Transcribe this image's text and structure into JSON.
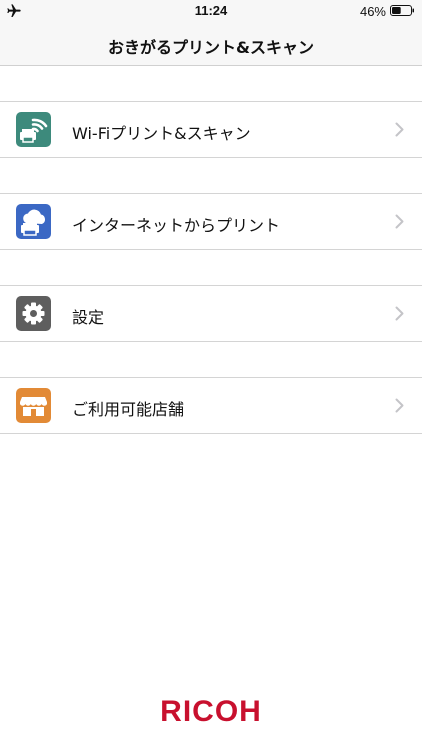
{
  "status_bar": {
    "time": "11:24",
    "battery_percent": "46%",
    "battery_level": 0.46,
    "mode_icon": "airplane-icon"
  },
  "nav": {
    "title": "おきがるプリント&スキャン"
  },
  "menu": [
    {
      "label": "Wi-Fiプリント&スキャン",
      "icon": "wifi-printer-icon",
      "color": "#3d8a7c"
    },
    {
      "label": "インターネットからプリント",
      "icon": "cloud-printer-icon",
      "color": "#3b68c4"
    },
    {
      "label": "設定",
      "icon": "gear-icon",
      "color": "#5e5e5e"
    },
    {
      "label": "ご利用可能店舗",
      "icon": "store-icon",
      "color": "#e28a36"
    }
  ],
  "footer": {
    "logo_text": "RICOH",
    "brand_color": "#c8102e"
  }
}
